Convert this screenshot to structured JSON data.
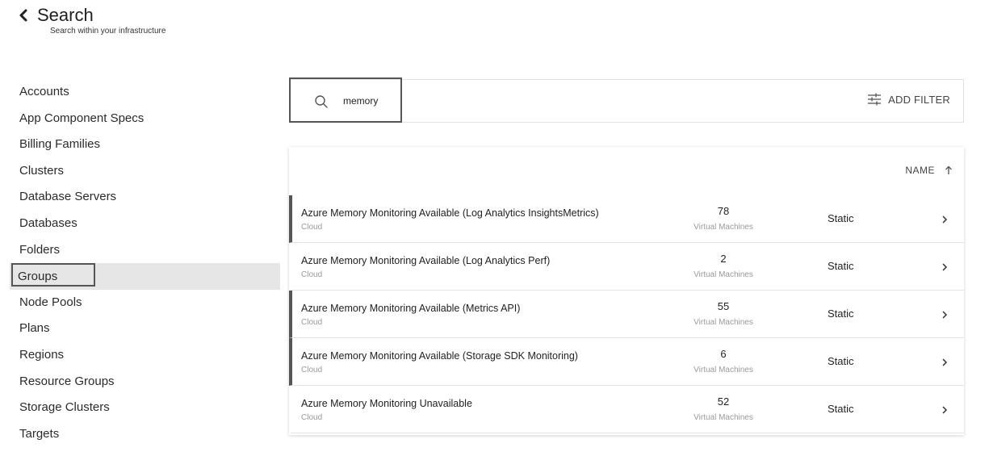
{
  "header": {
    "title": "Search",
    "subtitle": "Search within your infrastructure",
    "back_icon": "chevron-left-icon"
  },
  "sidebar": {
    "items": [
      {
        "label": "Accounts"
      },
      {
        "label": "App Component Specs"
      },
      {
        "label": "Billing Families"
      },
      {
        "label": "Clusters"
      },
      {
        "label": "Database Servers"
      },
      {
        "label": "Databases"
      },
      {
        "label": "Folders"
      },
      {
        "label": "Groups",
        "selected": true
      },
      {
        "label": "Node Pools"
      },
      {
        "label": "Plans"
      },
      {
        "label": "Regions"
      },
      {
        "label": "Resource Groups"
      },
      {
        "label": "Storage Clusters"
      },
      {
        "label": "Targets"
      }
    ]
  },
  "search": {
    "value": "memory",
    "icon": "search-icon",
    "add_filter_label": "ADD FILTER",
    "add_filter_icon": "filter-sliders-icon"
  },
  "results": {
    "sort_label": "NAME",
    "sort_icon": "arrow-up-icon",
    "rows": [
      {
        "name": "Azure Memory Monitoring Available (Log Analytics InsightsMetrics)",
        "category": "Cloud",
        "count": "78",
        "count_label": "Virtual Machines",
        "type": "Static",
        "marked": true
      },
      {
        "name": "Azure Memory Monitoring Available (Log Analytics Perf)",
        "category": "Cloud",
        "count": "2",
        "count_label": "Virtual Machines",
        "type": "Static",
        "marked": false
      },
      {
        "name": "Azure Memory Monitoring Available (Metrics API)",
        "category": "Cloud",
        "count": "55",
        "count_label": "Virtual Machines",
        "type": "Static",
        "marked": true
      },
      {
        "name": "Azure Memory Monitoring Available (Storage SDK Monitoring)",
        "category": "Cloud",
        "count": "6",
        "count_label": "Virtual Machines",
        "type": "Static",
        "marked": true
      },
      {
        "name": "Azure Memory Monitoring Unavailable",
        "category": "Cloud",
        "count": "52",
        "count_label": "Virtual Machines",
        "type": "Static",
        "marked": false
      }
    ]
  },
  "colors": {
    "selected_bg": "#e6e6e6",
    "marker": "#555555",
    "muted_text": "#9a9a9a"
  }
}
